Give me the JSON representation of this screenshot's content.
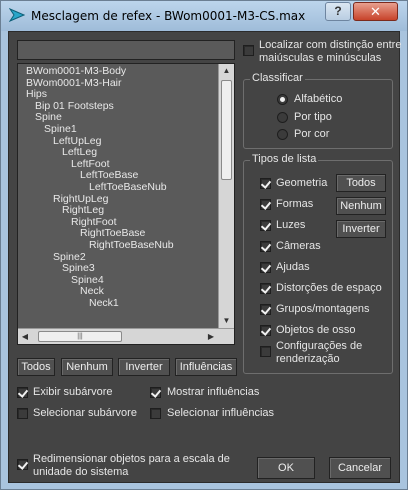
{
  "window": {
    "title": "Mesclagem de refex - BWom0001-M3-CS.max",
    "help_label": "?",
    "close_label": "✕"
  },
  "tree": {
    "items": [
      {
        "label": "BWom0001-M3-Body",
        "depth": 0
      },
      {
        "label": "BWom0001-M3-Hair",
        "depth": 0
      },
      {
        "label": "Hips",
        "depth": 0
      },
      {
        "label": "Bip 01 Footsteps",
        "depth": 1
      },
      {
        "label": "Spine",
        "depth": 1
      },
      {
        "label": "Spine1",
        "depth": 2
      },
      {
        "label": "LeftUpLeg",
        "depth": 3
      },
      {
        "label": "LeftLeg",
        "depth": 4
      },
      {
        "label": "LeftFoot",
        "depth": 5
      },
      {
        "label": "LeftToeBase",
        "depth": 6
      },
      {
        "label": "LeftToeBaseNub",
        "depth": 7
      },
      {
        "label": "RightUpLeg",
        "depth": 3
      },
      {
        "label": "RightLeg",
        "depth": 4
      },
      {
        "label": "RightFoot",
        "depth": 5
      },
      {
        "label": "RightToeBase",
        "depth": 6
      },
      {
        "label": "RightToeBaseNub",
        "depth": 7
      },
      {
        "label": "Spine2",
        "depth": 3
      },
      {
        "label": "Spine3",
        "depth": 4
      },
      {
        "label": "Spine4",
        "depth": 5
      },
      {
        "label": "Neck",
        "depth": 6
      },
      {
        "label": "Neck1",
        "depth": 7
      }
    ]
  },
  "list_buttons": {
    "all": "Todos",
    "none": "Nenhum",
    "invert": "Inverter",
    "influences": "Influências"
  },
  "options": {
    "show_subtree": {
      "label": "Exibir subárvore",
      "checked": true
    },
    "show_influences": {
      "label": "Mostrar influências",
      "checked": true
    },
    "select_subtree": {
      "label": "Selecionar subárvore",
      "checked": false
    },
    "select_influences": {
      "label": "Selecionar influências",
      "checked": false
    },
    "rescale": {
      "label_line1": "Redimensionar objetos para a escala de",
      "label_line2": "unidade do sistema",
      "checked": true
    }
  },
  "case_sensitive": {
    "label_line1": "Localizar com distinção entre",
    "label_line2": "maiúsculas e minúsculas",
    "checked": false
  },
  "sort": {
    "title": "Classificar",
    "options": [
      {
        "label": "Alfabético",
        "selected": true
      },
      {
        "label": "Por tipo",
        "selected": false
      },
      {
        "label": "Por cor",
        "selected": false
      }
    ]
  },
  "list_types": {
    "title": "Tipos de lista",
    "items": [
      {
        "label": "Geometria",
        "checked": true
      },
      {
        "label": "Formas",
        "checked": true
      },
      {
        "label": "Luzes",
        "checked": true
      },
      {
        "label": "Câmeras",
        "checked": true
      },
      {
        "label": "Ajudas",
        "checked": true
      },
      {
        "label": "Distorções de espaço",
        "checked": true
      },
      {
        "label": "Grupos/montagens",
        "checked": true
      },
      {
        "label": "Objetos de osso",
        "checked": true
      },
      {
        "label": "Configurações de",
        "label2": "renderização",
        "checked": false
      }
    ],
    "all": "Todos",
    "none": "Nenhum",
    "invert": "Inverter"
  },
  "footer": {
    "ok": "OK",
    "cancel": "Cancelar"
  },
  "colors": {
    "titlebar": "#a9c4de",
    "background": "#444444",
    "list_background": "#5a5a5a",
    "close_button": "#c7432a"
  }
}
